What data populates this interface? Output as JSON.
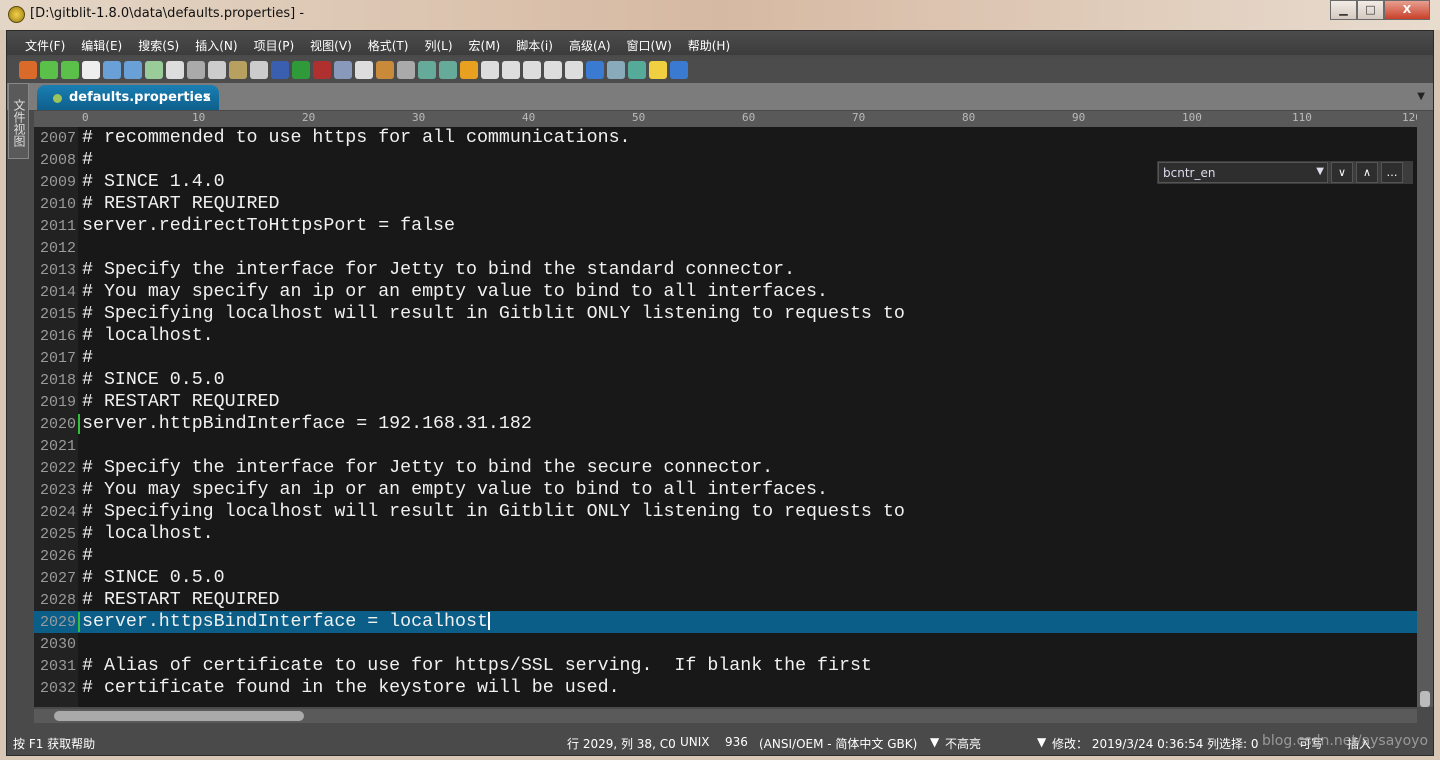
{
  "window": {
    "title": "[D:\\gitblit-1.8.0\\data\\defaults.properties] -",
    "minimize": "▁",
    "maximize": "□",
    "close": "X"
  },
  "menu": [
    "文件(F)",
    "编辑(E)",
    "搜索(S)",
    "插入(N)",
    "项目(P)",
    "视图(V)",
    "格式(T)",
    "列(L)",
    "宏(M)",
    "脚本(i)",
    "高级(A)",
    "窗口(W)",
    "帮助(H)"
  ],
  "side_panel": "文件视图",
  "tab": {
    "label": "defaults.properties",
    "close": "x"
  },
  "ruler": [
    "0",
    "10",
    "20",
    "30",
    "40",
    "50",
    "60",
    "70",
    "80",
    "90",
    "100",
    "110",
    "120"
  ],
  "find": {
    "value": "bcntr_en"
  },
  "editor": {
    "current_line": "2029",
    "lines": [
      {
        "n": "2007",
        "t": "# recommended to use https for all communications."
      },
      {
        "n": "2008",
        "t": "#"
      },
      {
        "n": "2009",
        "t": "# SINCE 1.4.0"
      },
      {
        "n": "2010",
        "t": "# RESTART REQUIRED"
      },
      {
        "n": "2011",
        "t": "server.redirectToHttpsPort = false"
      },
      {
        "n": "2012",
        "t": ""
      },
      {
        "n": "2013",
        "t": "# Specify the interface for Jetty to bind the standard connector."
      },
      {
        "n": "2014",
        "t": "# You may specify an ip or an empty value to bind to all interfaces."
      },
      {
        "n": "2015",
        "t": "# Specifying localhost will result in Gitblit ONLY listening to requests to"
      },
      {
        "n": "2016",
        "t": "# localhost."
      },
      {
        "n": "2017",
        "t": "#"
      },
      {
        "n": "2018",
        "t": "# SINCE 0.5.0"
      },
      {
        "n": "2019",
        "t": "# RESTART REQUIRED"
      },
      {
        "n": "2020",
        "t": "server.httpBindInterface = 192.168.31.182"
      },
      {
        "n": "2021",
        "t": ""
      },
      {
        "n": "2022",
        "t": "# Specify the interface for Jetty to bind the secure connector."
      },
      {
        "n": "2023",
        "t": "# You may specify an ip or an empty value to bind to all interfaces."
      },
      {
        "n": "2024",
        "t": "# Specifying localhost will result in Gitblit ONLY listening to requests to"
      },
      {
        "n": "2025",
        "t": "# localhost."
      },
      {
        "n": "2026",
        "t": "#"
      },
      {
        "n": "2027",
        "t": "# SINCE 0.5.0"
      },
      {
        "n": "2028",
        "t": "# RESTART REQUIRED"
      },
      {
        "n": "2029",
        "t": "server.httpsBindInterface = localhost"
      },
      {
        "n": "2030",
        "t": ""
      },
      {
        "n": "2031",
        "t": "# Alias of certificate to use for https/SSL serving.  If blank the first"
      },
      {
        "n": "2032",
        "t": "# certificate found in the keystore will be used."
      }
    ]
  },
  "status": {
    "help": "按 F1 获取帮助",
    "position": "行 2029, 列 38, C0",
    "eol": "UNIX",
    "codepage": "936",
    "encoding": "(ANSI/OEM - 简体中文 GBK)",
    "highlight": "不高亮",
    "modified": "修改： 2019/3/24 0:36:54",
    "colsel": "列选择: 0",
    "writable": "可写",
    "insert": "插入",
    "watermark": "blog.csdn.net/aysayoyo"
  },
  "colors": {
    "editor_bg": "#181818",
    "current_line": "#0b5e87",
    "tab": "#1a7fb3"
  }
}
